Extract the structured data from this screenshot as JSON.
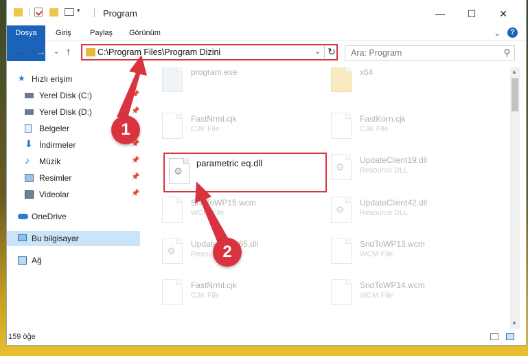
{
  "window": {
    "title": "Program",
    "minimize_glyph": "—",
    "maximize_glyph": "☐",
    "close_glyph": "✕"
  },
  "ribbon": {
    "tabs": [
      "Dosya",
      "Giriş",
      "Paylaş",
      "Görünüm"
    ],
    "help_glyph": "?",
    "expand_glyph": "⌄"
  },
  "nav": {
    "back_glyph": "←",
    "forward_glyph": "→",
    "recent_glyph": "⌄",
    "up_glyph": "↑",
    "address_path": "C:\\Program Files\\Program Dizini",
    "address_chevron": "⌄",
    "refresh_glyph": "↻",
    "search_placeholder": "Ara: Program",
    "search_icon_glyph": "⚲"
  },
  "sidebar": {
    "items": [
      {
        "label": "Hızlı erişim",
        "icon": "star-icon",
        "pinned": false
      },
      {
        "label": "Yerel Disk (C:)",
        "icon": "drive-icon",
        "pinned": true
      },
      {
        "label": "Yerel Disk (D:)",
        "icon": "drive-icon",
        "pinned": true
      },
      {
        "label": "Belgeler",
        "icon": "documents-icon",
        "pinned": true
      },
      {
        "label": "İndirmeler",
        "icon": "download-icon",
        "pinned": true
      },
      {
        "label": "Müzik",
        "icon": "music-icon",
        "pinned": true
      },
      {
        "label": "Resimler",
        "icon": "pictures-icon",
        "pinned": true
      },
      {
        "label": "Videolar",
        "icon": "videos-icon",
        "pinned": true
      },
      {
        "label": "OneDrive",
        "icon": "cloud-icon",
        "pinned": false
      },
      {
        "label": "Bu bilgisayar",
        "icon": "computer-icon",
        "pinned": false
      },
      {
        "label": "Ağ",
        "icon": "network-icon",
        "pinned": false
      }
    ],
    "pin_glyph": "📌"
  },
  "files": [
    {
      "name": "program.exe",
      "type": ""
    },
    {
      "name": "x64",
      "type": ""
    },
    {
      "name": "FastNrml.cjk",
      "type": "CJK File"
    },
    {
      "name": "FastKorn.cjk",
      "type": "CJK File"
    },
    {
      "name": "parametric eq.dll",
      "type": ""
    },
    {
      "name": "UpdateClient19.dll",
      "type": "Resource DLL"
    },
    {
      "name": "SndToWP15.wcm",
      "type": "WCM File"
    },
    {
      "name": "UpdateClient42.dll",
      "type": "Resource DLL"
    },
    {
      "name": "UpdateClient65.dll",
      "type": "Resource DLL"
    },
    {
      "name": "SndToWP13.wcm",
      "type": "WCM File"
    },
    {
      "name": "FastNrml.cjk",
      "type": "CJK File"
    },
    {
      "name": "SndToWP14.wcm",
      "type": "WCM File"
    }
  ],
  "status": {
    "count": "159 öğe"
  },
  "callouts": [
    "1",
    "2"
  ],
  "colors": {
    "accent": "#1a63b8",
    "highlight": "#d9333f",
    "selection": "#cce4f7"
  }
}
